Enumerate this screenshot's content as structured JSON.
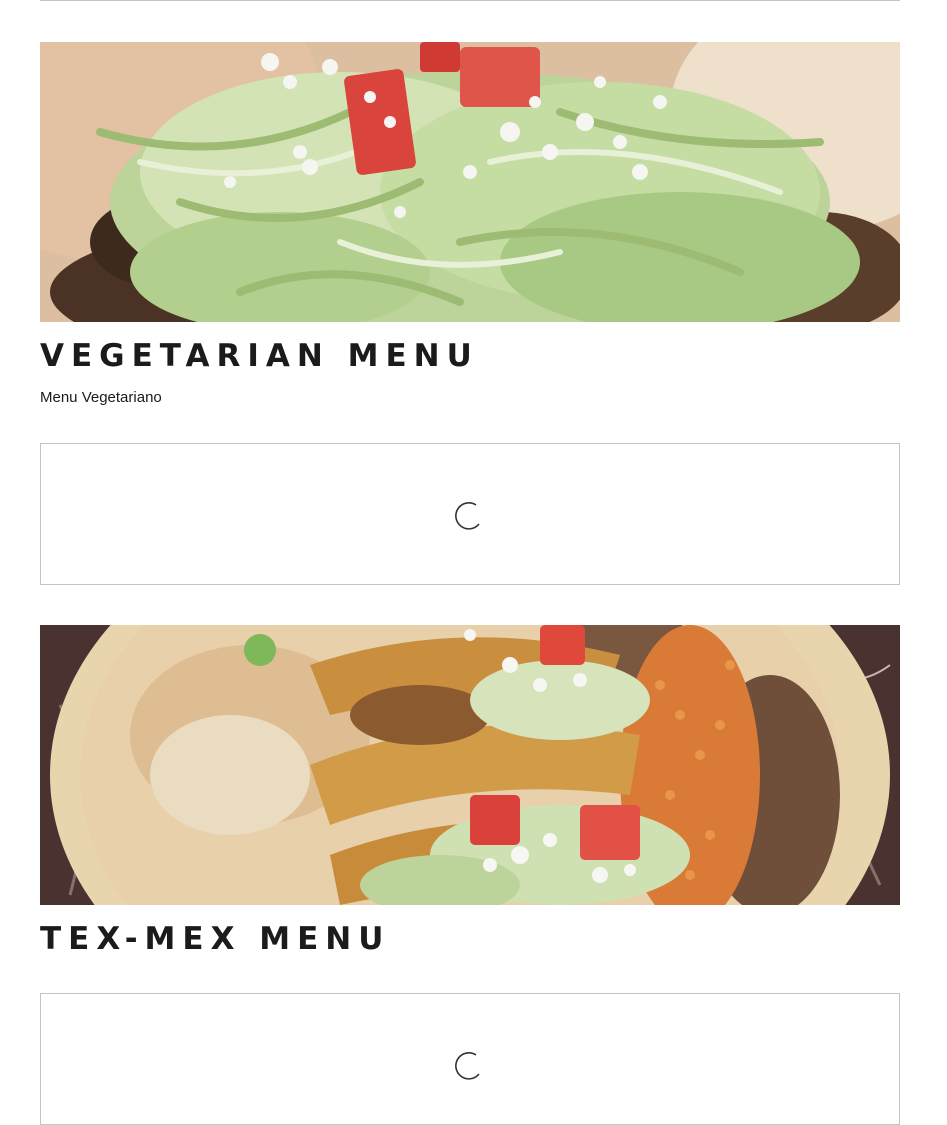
{
  "sections": [
    {
      "id": "vegetarian",
      "title": "VEGETARIAN MENU",
      "subtitle": "Menu Vegetariano",
      "image_icon": "tostada-photo",
      "embed_state": "loading-spinner"
    },
    {
      "id": "texmex",
      "title": "TEX-MEX MENU",
      "image_icon": "tacos-rice-beans-photo",
      "embed_state": "loading-spinner"
    }
  ],
  "colors": {
    "text": "#1b1b1b",
    "frame_border": "#c4c4c4",
    "spinner": "#333333",
    "background": "#ffffff"
  }
}
